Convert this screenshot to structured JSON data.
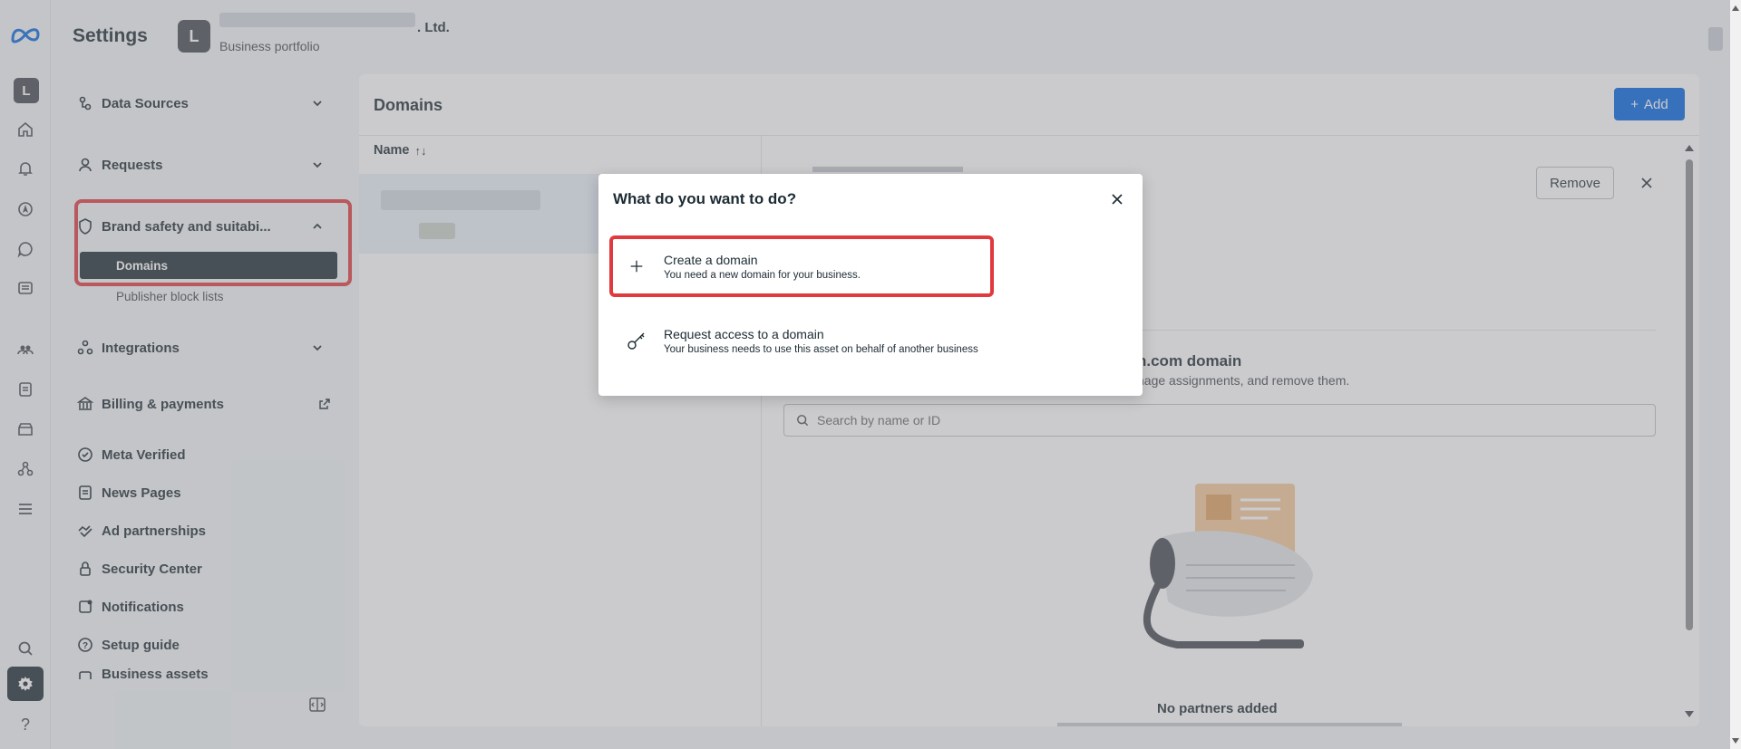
{
  "header": {
    "title": "Settings",
    "business_initial": "L",
    "business_name_suffix": ". Ltd.",
    "business_type": "Business portfolio"
  },
  "rail": {
    "avatar_initial": "L",
    "help_glyph": "?",
    "icons": [
      "meta-logo-icon",
      "home-icon",
      "bell-icon",
      "compass-icon",
      "chat-icon",
      "pages-icon",
      "people-icon",
      "document-icon",
      "store-icon",
      "connections-icon",
      "menu-icon",
      "search-icon",
      "gear-icon",
      "help-icon"
    ]
  },
  "sidebar": {
    "items": [
      {
        "label": "Data Sources",
        "icon": "data-sources-icon"
      },
      {
        "label": "Requests",
        "icon": "person-icon"
      },
      {
        "label": "Brand safety and suitabi...",
        "icon": "shield-icon"
      },
      {
        "label": "Integrations",
        "icon": "integrations-icon"
      },
      {
        "label": "Billing & payments",
        "icon": "bank-icon"
      },
      {
        "label": "Meta Verified",
        "icon": "verified-icon"
      },
      {
        "label": "News Pages",
        "icon": "news-icon"
      },
      {
        "label": "Ad partnerships",
        "icon": "handshake-icon"
      },
      {
        "label": "Security Center",
        "icon": "lock-icon"
      },
      {
        "label": "Notifications",
        "icon": "notification-icon"
      },
      {
        "label": "Setup guide",
        "icon": "question-icon"
      },
      {
        "label": "Business assets",
        "icon": "assets-icon"
      }
    ],
    "sub_items": [
      {
        "label": "Domains",
        "active": true
      },
      {
        "label": "Publisher block lists",
        "active": false
      }
    ]
  },
  "main": {
    "title": "Domains",
    "add_label": "Add",
    "column_name": "Name",
    "sort_glyph": "↑↓",
    "remove_label": "Remove",
    "partners_title": "n.com domain",
    "partners_sub": "nage assignments, and remove them.",
    "search_placeholder": "Search by name or ID",
    "no_partners": "No partners added"
  },
  "modal": {
    "title": "What do you want to do?",
    "options": [
      {
        "title": "Create a domain",
        "desc": "You need a new domain for your business.",
        "icon": "plus-icon"
      },
      {
        "title": "Request access to a domain",
        "desc": "Your business needs to use this asset on behalf of another business",
        "icon": "key-icon"
      }
    ]
  },
  "colors": {
    "primary": "#0064e0",
    "highlight": "#e0393e",
    "dark": "#1c2b33"
  }
}
